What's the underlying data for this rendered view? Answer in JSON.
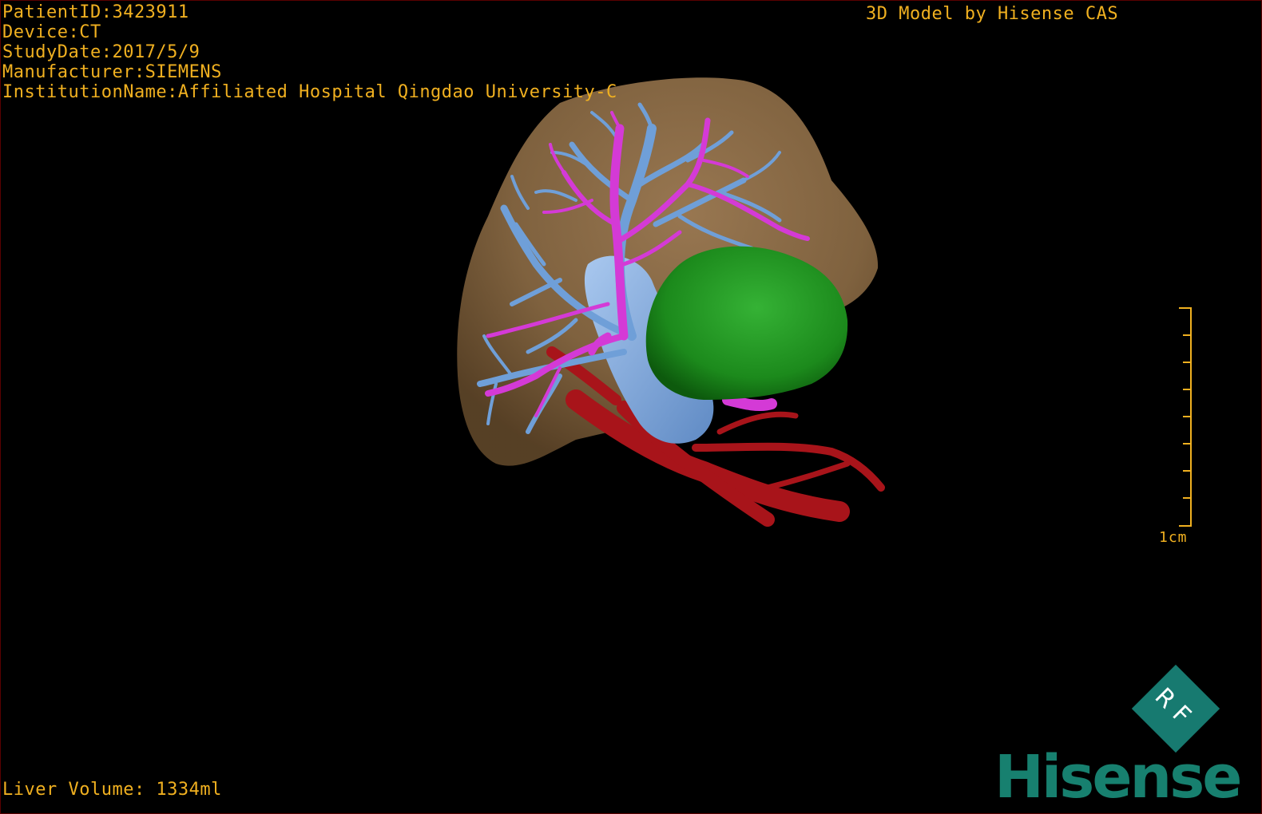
{
  "header": {
    "patient_id": "PatientID:3423911",
    "device": "Device:CT",
    "study_date": "StudyDate:2017/5/9",
    "manufacturer": "Manufacturer:SIEMENS",
    "institution": "InstitutionName:Affiliated Hospital Qingdao University-C"
  },
  "credit": "3D Model by Hisense CAS",
  "footer": {
    "liver_volume": "Liver Volume: 1334ml"
  },
  "scale": {
    "label": "1cm"
  },
  "logo": {
    "diamond_text": "RF",
    "brand": "Hisense"
  },
  "colors": {
    "overlay_text": "#f0b020",
    "liver": "#8a6a44",
    "portal_vein": "#6f9fd8",
    "hepatic_vein": "#d43ad6",
    "artery": "#a8141a",
    "tumor": "#1f8a1f",
    "brand": "#17806f"
  }
}
